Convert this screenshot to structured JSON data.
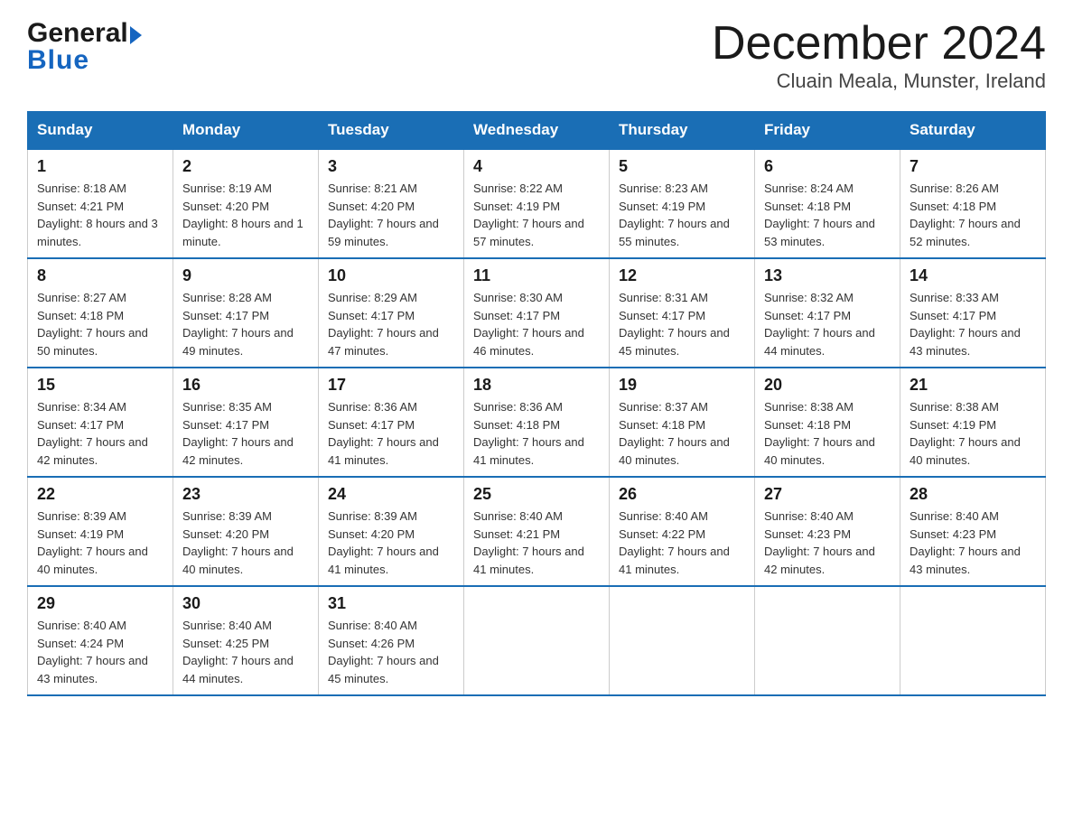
{
  "header": {
    "logo_general": "General",
    "logo_blue": "Blue",
    "month_title": "December 2024",
    "location": "Cluain Meala, Munster, Ireland"
  },
  "days_of_week": [
    "Sunday",
    "Monday",
    "Tuesday",
    "Wednesday",
    "Thursday",
    "Friday",
    "Saturday"
  ],
  "weeks": [
    [
      {
        "day": "1",
        "sunrise": "8:18 AM",
        "sunset": "4:21 PM",
        "daylight": "8 hours and 3 minutes."
      },
      {
        "day": "2",
        "sunrise": "8:19 AM",
        "sunset": "4:20 PM",
        "daylight": "8 hours and 1 minute."
      },
      {
        "day": "3",
        "sunrise": "8:21 AM",
        "sunset": "4:20 PM",
        "daylight": "7 hours and 59 minutes."
      },
      {
        "day": "4",
        "sunrise": "8:22 AM",
        "sunset": "4:19 PM",
        "daylight": "7 hours and 57 minutes."
      },
      {
        "day": "5",
        "sunrise": "8:23 AM",
        "sunset": "4:19 PM",
        "daylight": "7 hours and 55 minutes."
      },
      {
        "day": "6",
        "sunrise": "8:24 AM",
        "sunset": "4:18 PM",
        "daylight": "7 hours and 53 minutes."
      },
      {
        "day": "7",
        "sunrise": "8:26 AM",
        "sunset": "4:18 PM",
        "daylight": "7 hours and 52 minutes."
      }
    ],
    [
      {
        "day": "8",
        "sunrise": "8:27 AM",
        "sunset": "4:18 PM",
        "daylight": "7 hours and 50 minutes."
      },
      {
        "day": "9",
        "sunrise": "8:28 AM",
        "sunset": "4:17 PM",
        "daylight": "7 hours and 49 minutes."
      },
      {
        "day": "10",
        "sunrise": "8:29 AM",
        "sunset": "4:17 PM",
        "daylight": "7 hours and 47 minutes."
      },
      {
        "day": "11",
        "sunrise": "8:30 AM",
        "sunset": "4:17 PM",
        "daylight": "7 hours and 46 minutes."
      },
      {
        "day": "12",
        "sunrise": "8:31 AM",
        "sunset": "4:17 PM",
        "daylight": "7 hours and 45 minutes."
      },
      {
        "day": "13",
        "sunrise": "8:32 AM",
        "sunset": "4:17 PM",
        "daylight": "7 hours and 44 minutes."
      },
      {
        "day": "14",
        "sunrise": "8:33 AM",
        "sunset": "4:17 PM",
        "daylight": "7 hours and 43 minutes."
      }
    ],
    [
      {
        "day": "15",
        "sunrise": "8:34 AM",
        "sunset": "4:17 PM",
        "daylight": "7 hours and 42 minutes."
      },
      {
        "day": "16",
        "sunrise": "8:35 AM",
        "sunset": "4:17 PM",
        "daylight": "7 hours and 42 minutes."
      },
      {
        "day": "17",
        "sunrise": "8:36 AM",
        "sunset": "4:17 PM",
        "daylight": "7 hours and 41 minutes."
      },
      {
        "day": "18",
        "sunrise": "8:36 AM",
        "sunset": "4:18 PM",
        "daylight": "7 hours and 41 minutes."
      },
      {
        "day": "19",
        "sunrise": "8:37 AM",
        "sunset": "4:18 PM",
        "daylight": "7 hours and 40 minutes."
      },
      {
        "day": "20",
        "sunrise": "8:38 AM",
        "sunset": "4:18 PM",
        "daylight": "7 hours and 40 minutes."
      },
      {
        "day": "21",
        "sunrise": "8:38 AM",
        "sunset": "4:19 PM",
        "daylight": "7 hours and 40 minutes."
      }
    ],
    [
      {
        "day": "22",
        "sunrise": "8:39 AM",
        "sunset": "4:19 PM",
        "daylight": "7 hours and 40 minutes."
      },
      {
        "day": "23",
        "sunrise": "8:39 AM",
        "sunset": "4:20 PM",
        "daylight": "7 hours and 40 minutes."
      },
      {
        "day": "24",
        "sunrise": "8:39 AM",
        "sunset": "4:20 PM",
        "daylight": "7 hours and 41 minutes."
      },
      {
        "day": "25",
        "sunrise": "8:40 AM",
        "sunset": "4:21 PM",
        "daylight": "7 hours and 41 minutes."
      },
      {
        "day": "26",
        "sunrise": "8:40 AM",
        "sunset": "4:22 PM",
        "daylight": "7 hours and 41 minutes."
      },
      {
        "day": "27",
        "sunrise": "8:40 AM",
        "sunset": "4:23 PM",
        "daylight": "7 hours and 42 minutes."
      },
      {
        "day": "28",
        "sunrise": "8:40 AM",
        "sunset": "4:23 PM",
        "daylight": "7 hours and 43 minutes."
      }
    ],
    [
      {
        "day": "29",
        "sunrise": "8:40 AM",
        "sunset": "4:24 PM",
        "daylight": "7 hours and 43 minutes."
      },
      {
        "day": "30",
        "sunrise": "8:40 AM",
        "sunset": "4:25 PM",
        "daylight": "7 hours and 44 minutes."
      },
      {
        "day": "31",
        "sunrise": "8:40 AM",
        "sunset": "4:26 PM",
        "daylight": "7 hours and 45 minutes."
      },
      null,
      null,
      null,
      null
    ]
  ],
  "labels": {
    "sunrise": "Sunrise:",
    "sunset": "Sunset:",
    "daylight": "Daylight:"
  }
}
